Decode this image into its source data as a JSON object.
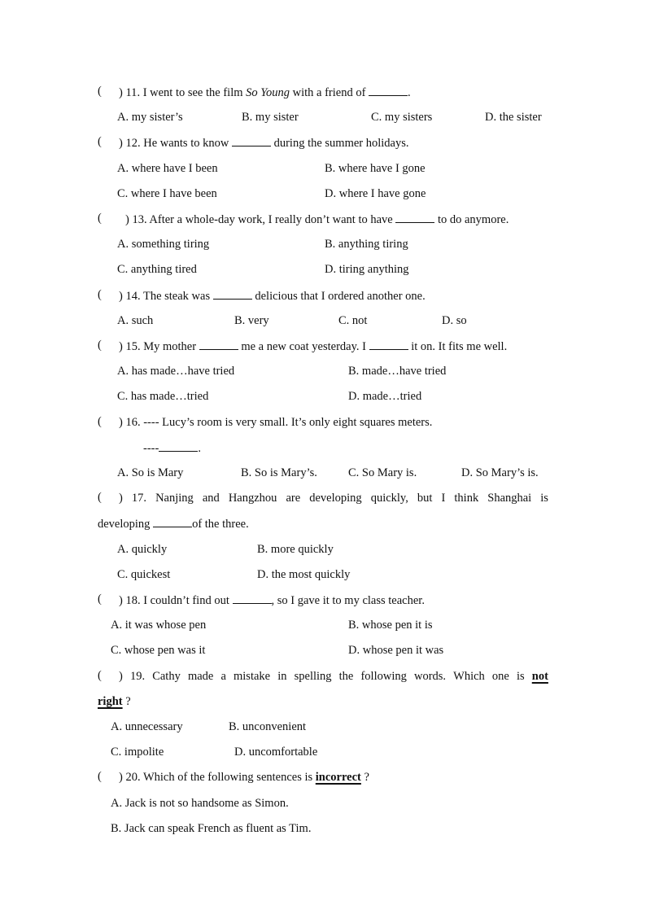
{
  "questions": [
    {
      "number": "11",
      "stem_before": "I went to see the film ",
      "stem_italic": "So Young",
      "stem_after": " with a friend of ",
      "stem_end": ".",
      "options": [
        "A. my sister’s",
        "B. my sister",
        "C. my sisters",
        "D. the sister"
      ]
    },
    {
      "number": "12",
      "stem_before": "He wants to know ",
      "stem_after": " during the summer holidays.",
      "options": [
        "A. where have I been",
        "B. where have I gone",
        "C. where I have been",
        "D. where I have gone"
      ]
    },
    {
      "number": "13",
      "stem_before": "After a whole-day work, I really  don’t want to have ",
      "stem_after": " to do anymore.",
      "options": [
        "A. something tiring",
        "B. anything tiring",
        "C. anything tired",
        "D. tiring anything"
      ]
    },
    {
      "number": "14",
      "stem_before": "The steak was ",
      "stem_after": " delicious that I ordered another one.",
      "options": [
        "A. such",
        "B. very",
        "C. not",
        "D. so"
      ]
    },
    {
      "number": "15",
      "stem_before": "My mother ",
      "stem_middle": " me a new coat yesterday. I ",
      "stem_after": " it on. It fits me well.",
      "options": [
        "A. has made…have tried",
        "B. made…have tried",
        "C. has made…tried",
        "D. made…tried"
      ]
    },
    {
      "number": "16",
      "stem_before": "---- Lucy’s room is very small. It’s only eight squares meters.",
      "reply_prefix": "----",
      "reply_end": ".",
      "options": [
        "A. So is Mary",
        "B. So is Mary’s.",
        "C. So Mary is.",
        "D. So Mary’s is."
      ]
    },
    {
      "number": "17",
      "stem_words": [
        "17.",
        "Nanjing",
        "and",
        "Hangzhou",
        "are",
        "developing",
        "quickly,",
        "but",
        "I",
        "think",
        "Shanghai",
        "is"
      ],
      "stem_line2_before": "developing ",
      "stem_line2_after": "of the three.",
      "options": [
        "A. quickly",
        "B. more quickly",
        "C. quickest",
        "D. the most quickly"
      ]
    },
    {
      "number": "18",
      "stem_before": "I couldn’t find out ",
      "stem_after": ", so I gave it to my class teacher.",
      "options": [
        "A. it was whose pen",
        "B. whose pen it is",
        "C. whose pen was it",
        "D. whose pen it was"
      ]
    },
    {
      "number": "19",
      "stem_words": [
        "19.",
        "Cathy",
        "made",
        "a",
        "mistake",
        "in",
        "spelling",
        "the",
        "following",
        "words.",
        "Which",
        "one",
        "is"
      ],
      "emphasis_1": "not",
      "emphasis_2": "right",
      "stem_end": " ?",
      "options": [
        "A. unnecessary",
        "B. unconvenient",
        "C. impolite",
        "D. uncomfortable"
      ]
    },
    {
      "number": "20",
      "stem_before": "Which of the following sentences is ",
      "emphasis": "incorrect",
      "stem_end": " ?",
      "options": [
        "A. Jack is not so handsome as Simon.",
        "B. Jack can speak French as fluent as Tim."
      ]
    }
  ],
  "paren_open": "(",
  "paren_close": ")"
}
